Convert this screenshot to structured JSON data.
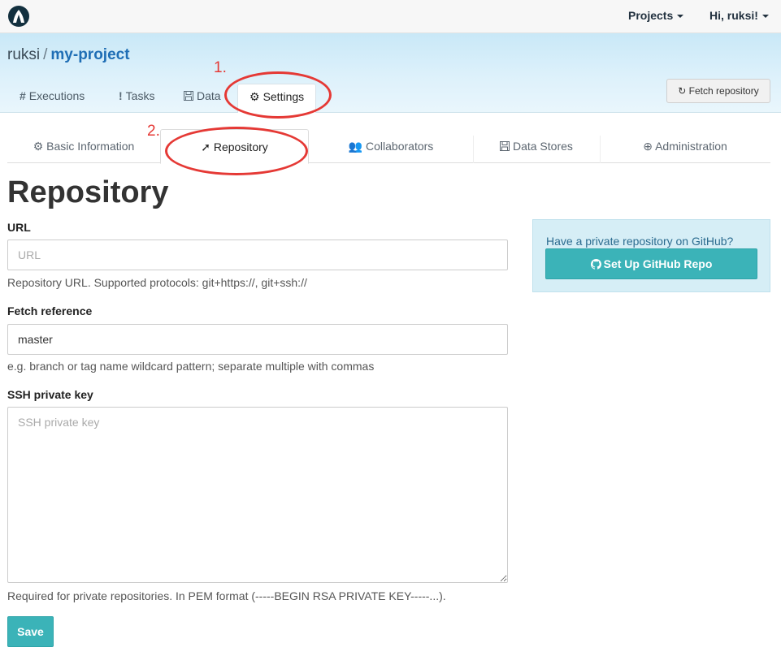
{
  "navbar": {
    "projects_label": "Projects",
    "user_label": "Hi, ruksi!"
  },
  "breadcrumb": {
    "owner": "ruksi",
    "separator": "/",
    "project": "my-project"
  },
  "project_tabs": [
    {
      "label": "Executions",
      "icon": "#"
    },
    {
      "label": "Tasks",
      "icon": "!"
    },
    {
      "label": "Data",
      "icon": "floppy-icon"
    },
    {
      "label": "Settings",
      "icon": "gear-icon"
    }
  ],
  "fetch_button": {
    "label": "Fetch repository",
    "icon": "refresh-icon"
  },
  "settings_tabs": [
    {
      "label": "Basic Information",
      "icon": "cogs-icon"
    },
    {
      "label": "Repository",
      "icon": "rocket-icon"
    },
    {
      "label": "Collaborators",
      "icon": "users-icon"
    },
    {
      "label": "Data Stores",
      "icon": "floppy-icon"
    },
    {
      "label": "Administration",
      "icon": "lifebuoy-icon"
    }
  ],
  "annotations": {
    "one": "1.",
    "two": "2."
  },
  "page": {
    "title": "Repository"
  },
  "form": {
    "url": {
      "label": "URL",
      "placeholder": "URL",
      "value": "",
      "help": "Repository URL. Supported protocols: git+https://, git+ssh://"
    },
    "fetch_ref": {
      "label": "Fetch reference",
      "value": "master",
      "help": "e.g. branch or tag name wildcard pattern; separate multiple with commas"
    },
    "ssh_key": {
      "label": "SSH private key",
      "placeholder": "SSH private key",
      "help": "Required for private repositories. In PEM format (-----BEGIN RSA PRIVATE KEY-----...)."
    },
    "save_label": "Save"
  },
  "github_box": {
    "text": "Have a private repository on GitHub?",
    "button_label": "Set Up GitHub Repo"
  },
  "colors": {
    "accent": "#3bb3b8",
    "annotation": "#e53935",
    "project_link": "#1f6eb5"
  }
}
